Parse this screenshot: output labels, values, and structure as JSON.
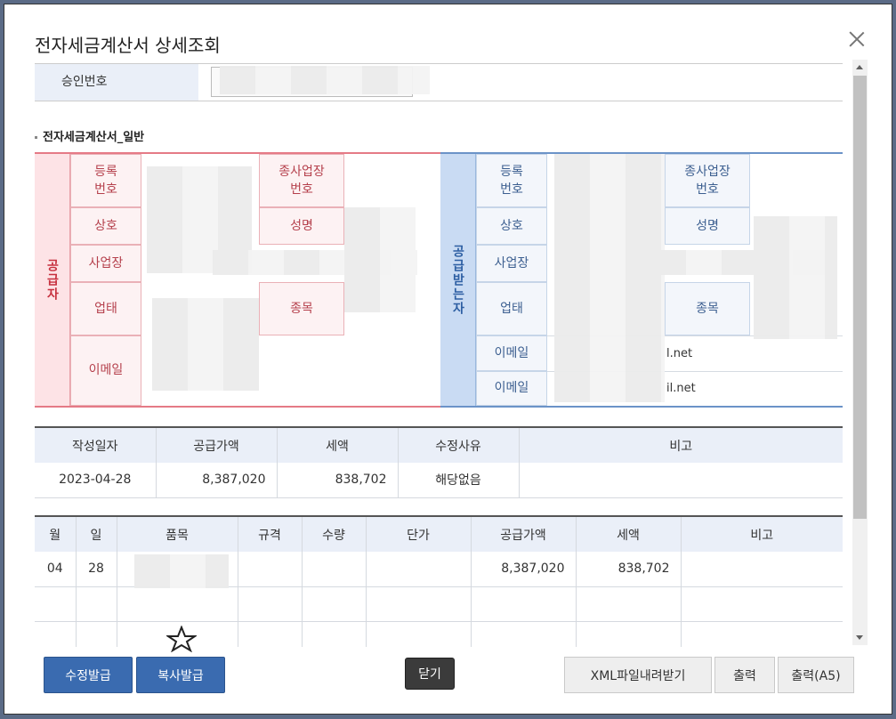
{
  "dialog": {
    "title": "전자세금계산서 상세조회"
  },
  "approval": {
    "label": "승인번호"
  },
  "section": {
    "general": "전자세금계산서_일반"
  },
  "supplier": {
    "side_label": "공급자",
    "reg_no": "등록\n번호",
    "branch_no": "종사업장\n번호",
    "company": "상호",
    "name": "성명",
    "address": "사업장",
    "biz_type": "업태",
    "biz_item": "종목",
    "email": "이메일"
  },
  "receiver": {
    "side_label": "공급받는자",
    "reg_no": "등록\n번호",
    "branch_no": "종사업장\n번호",
    "company": "상호",
    "name": "성명",
    "address": "사업장",
    "biz_type": "업태",
    "biz_item": "종목",
    "email1": "이메일",
    "email1_value": "l.net",
    "email2": "이메일",
    "email2_value": "il.net"
  },
  "summary": {
    "headers": [
      "작성일자",
      "공급가액",
      "세액",
      "수정사유",
      "비고"
    ],
    "row": [
      "2023-04-28",
      "8,387,020",
      "838,702",
      "해당없음",
      ""
    ]
  },
  "items": {
    "headers": [
      "월",
      "일",
      "품목",
      "규격",
      "수량",
      "단가",
      "공급가액",
      "세액",
      "비고"
    ],
    "rows": [
      [
        "04",
        "28",
        "",
        "",
        "",
        "",
        "8,387,020",
        "838,702",
        ""
      ],
      [
        "",
        "",
        "",
        "",
        "",
        "",
        "",
        "",
        ""
      ],
      [
        "",
        "",
        "",
        "",
        "",
        "",
        "",
        "",
        ""
      ]
    ]
  },
  "buttons": {
    "modify": "수정발급",
    "copy": "복사발급",
    "close": "닫기",
    "xml": "XML파일내려받기",
    "print": "출력",
    "print_a5": "출력(A5)"
  }
}
